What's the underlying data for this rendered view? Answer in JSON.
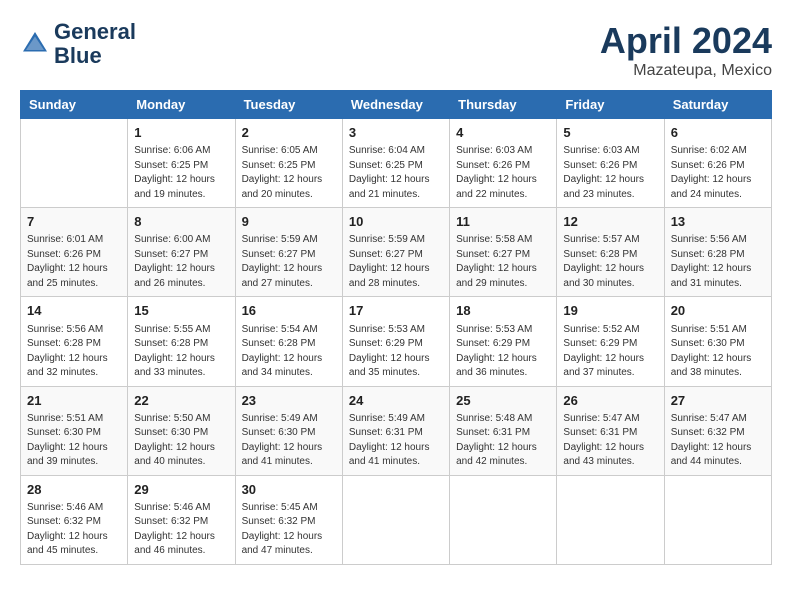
{
  "header": {
    "logo_line1": "General",
    "logo_line2": "Blue",
    "title": "April 2024",
    "subtitle": "Mazateupa, Mexico"
  },
  "weekdays": [
    "Sunday",
    "Monday",
    "Tuesday",
    "Wednesday",
    "Thursday",
    "Friday",
    "Saturday"
  ],
  "weeks": [
    [
      {
        "day": "",
        "info": ""
      },
      {
        "day": "1",
        "info": "Sunrise: 6:06 AM\nSunset: 6:25 PM\nDaylight: 12 hours\nand 19 minutes."
      },
      {
        "day": "2",
        "info": "Sunrise: 6:05 AM\nSunset: 6:25 PM\nDaylight: 12 hours\nand 20 minutes."
      },
      {
        "day": "3",
        "info": "Sunrise: 6:04 AM\nSunset: 6:25 PM\nDaylight: 12 hours\nand 21 minutes."
      },
      {
        "day": "4",
        "info": "Sunrise: 6:03 AM\nSunset: 6:26 PM\nDaylight: 12 hours\nand 22 minutes."
      },
      {
        "day": "5",
        "info": "Sunrise: 6:03 AM\nSunset: 6:26 PM\nDaylight: 12 hours\nand 23 minutes."
      },
      {
        "day": "6",
        "info": "Sunrise: 6:02 AM\nSunset: 6:26 PM\nDaylight: 12 hours\nand 24 minutes."
      }
    ],
    [
      {
        "day": "7",
        "info": "Sunrise: 6:01 AM\nSunset: 6:26 PM\nDaylight: 12 hours\nand 25 minutes."
      },
      {
        "day": "8",
        "info": "Sunrise: 6:00 AM\nSunset: 6:27 PM\nDaylight: 12 hours\nand 26 minutes."
      },
      {
        "day": "9",
        "info": "Sunrise: 5:59 AM\nSunset: 6:27 PM\nDaylight: 12 hours\nand 27 minutes."
      },
      {
        "day": "10",
        "info": "Sunrise: 5:59 AM\nSunset: 6:27 PM\nDaylight: 12 hours\nand 28 minutes."
      },
      {
        "day": "11",
        "info": "Sunrise: 5:58 AM\nSunset: 6:27 PM\nDaylight: 12 hours\nand 29 minutes."
      },
      {
        "day": "12",
        "info": "Sunrise: 5:57 AM\nSunset: 6:28 PM\nDaylight: 12 hours\nand 30 minutes."
      },
      {
        "day": "13",
        "info": "Sunrise: 5:56 AM\nSunset: 6:28 PM\nDaylight: 12 hours\nand 31 minutes."
      }
    ],
    [
      {
        "day": "14",
        "info": "Sunrise: 5:56 AM\nSunset: 6:28 PM\nDaylight: 12 hours\nand 32 minutes."
      },
      {
        "day": "15",
        "info": "Sunrise: 5:55 AM\nSunset: 6:28 PM\nDaylight: 12 hours\nand 33 minutes."
      },
      {
        "day": "16",
        "info": "Sunrise: 5:54 AM\nSunset: 6:28 PM\nDaylight: 12 hours\nand 34 minutes."
      },
      {
        "day": "17",
        "info": "Sunrise: 5:53 AM\nSunset: 6:29 PM\nDaylight: 12 hours\nand 35 minutes."
      },
      {
        "day": "18",
        "info": "Sunrise: 5:53 AM\nSunset: 6:29 PM\nDaylight: 12 hours\nand 36 minutes."
      },
      {
        "day": "19",
        "info": "Sunrise: 5:52 AM\nSunset: 6:29 PM\nDaylight: 12 hours\nand 37 minutes."
      },
      {
        "day": "20",
        "info": "Sunrise: 5:51 AM\nSunset: 6:30 PM\nDaylight: 12 hours\nand 38 minutes."
      }
    ],
    [
      {
        "day": "21",
        "info": "Sunrise: 5:51 AM\nSunset: 6:30 PM\nDaylight: 12 hours\nand 39 minutes."
      },
      {
        "day": "22",
        "info": "Sunrise: 5:50 AM\nSunset: 6:30 PM\nDaylight: 12 hours\nand 40 minutes."
      },
      {
        "day": "23",
        "info": "Sunrise: 5:49 AM\nSunset: 6:30 PM\nDaylight: 12 hours\nand 41 minutes."
      },
      {
        "day": "24",
        "info": "Sunrise: 5:49 AM\nSunset: 6:31 PM\nDaylight: 12 hours\nand 41 minutes."
      },
      {
        "day": "25",
        "info": "Sunrise: 5:48 AM\nSunset: 6:31 PM\nDaylight: 12 hours\nand 42 minutes."
      },
      {
        "day": "26",
        "info": "Sunrise: 5:47 AM\nSunset: 6:31 PM\nDaylight: 12 hours\nand 43 minutes."
      },
      {
        "day": "27",
        "info": "Sunrise: 5:47 AM\nSunset: 6:32 PM\nDaylight: 12 hours\nand 44 minutes."
      }
    ],
    [
      {
        "day": "28",
        "info": "Sunrise: 5:46 AM\nSunset: 6:32 PM\nDaylight: 12 hours\nand 45 minutes."
      },
      {
        "day": "29",
        "info": "Sunrise: 5:46 AM\nSunset: 6:32 PM\nDaylight: 12 hours\nand 46 minutes."
      },
      {
        "day": "30",
        "info": "Sunrise: 5:45 AM\nSunset: 6:32 PM\nDaylight: 12 hours\nand 47 minutes."
      },
      {
        "day": "",
        "info": ""
      },
      {
        "day": "",
        "info": ""
      },
      {
        "day": "",
        "info": ""
      },
      {
        "day": "",
        "info": ""
      }
    ]
  ]
}
